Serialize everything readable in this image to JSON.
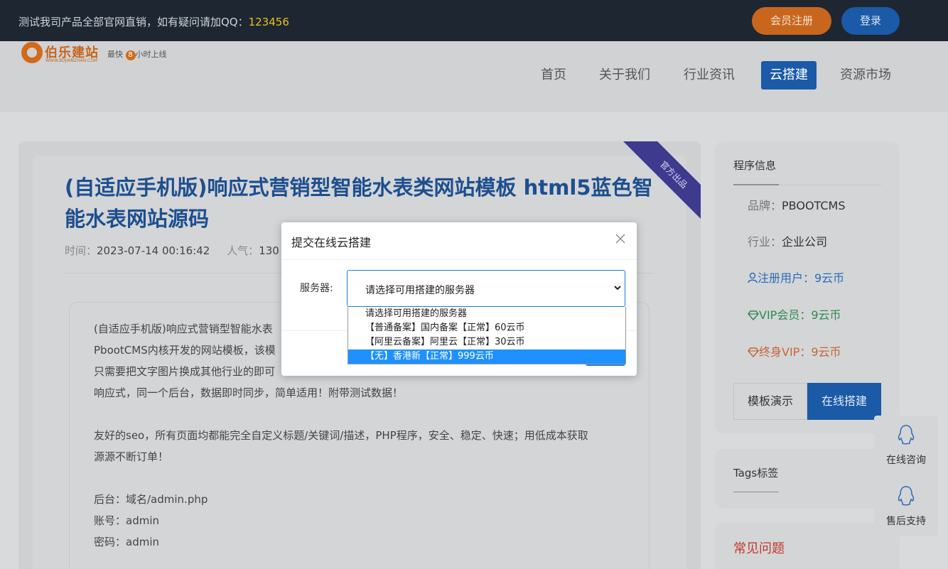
{
  "topbar": {
    "notice": "测试我司产品全部官网直销，如有疑问请加QQ：",
    "qq": "123456",
    "register_label": "会员注册",
    "login_label": "登录"
  },
  "logo": {
    "brand": "伯乐建站",
    "domain": "WWW.BOJIANZHAN.COM",
    "slogan_pre": "最快",
    "slogan_num": "8",
    "slogan_post": "小时上线"
  },
  "nav": {
    "items": [
      {
        "label": "首页"
      },
      {
        "label": "关于我们"
      },
      {
        "label": "行业资讯"
      },
      {
        "label": "云搭建"
      },
      {
        "label": "资源市场"
      }
    ],
    "active": "云搭建"
  },
  "article": {
    "ribbon": "官方出品",
    "title": "(自适应手机版)响应式营销型智能水表类网站模板 html5蓝色智能水表网站源码",
    "time_label": "时间：",
    "time_value": "2023-07-14 00:16:42",
    "views_label": "人气：",
    "views_value": "130",
    "paragraphs": [
      "(自适应手机版)响应式营销型智能水表",
      "PbootCMS内核开发的网站模板，该模",
      "只需要把文字图片换成其他行业的即可",
      "响应式，同一个后台，数据即时同步，简单适用！附带测试数据！",
      "友好的seo，所有页面均都能完全自定义标题/关键词/描述，PHP程序，安全、稳定、快速；用低成本获取",
      "源源不断订单！",
      "后台：域名/admin.php",
      "账号：admin",
      "密码：admin"
    ]
  },
  "sidebar": {
    "program_info": "程序信息",
    "brand_label": "品牌：",
    "brand_value": "PBOOTCMS",
    "industry_label": "行业：",
    "industry_value": "企业公司",
    "registered_user": "注册用户：9云币",
    "vip_member": "VIP会员：9云币",
    "lifetime_vip": "终身VIP：9云币",
    "demo_button": "模板演示",
    "online_build_button": "在线搭建",
    "tags_heading": "Tags标签",
    "faq_heading": "常见问题"
  },
  "float": {
    "consult": "在线咨询",
    "aftersale": "售后支持"
  },
  "modal": {
    "title": "提交在线云搭建",
    "server_label": "服务器:",
    "selected_value": "请选择可用搭建的服务器",
    "options": [
      "请选择可用搭建的服务器",
      "【普通备案】国内备案【正常】60云币",
      "【阿里云备案】阿里云【正常】30云币",
      "【无】香港新【正常】999云币"
    ],
    "highlighted_index": 3
  },
  "colors": {
    "topbar": "#1e2632",
    "accent_blue": "#1a5aa6",
    "register_orange": "#c9661e",
    "title_blue": "#1d4f8f",
    "faq_red": "#c0392b"
  }
}
